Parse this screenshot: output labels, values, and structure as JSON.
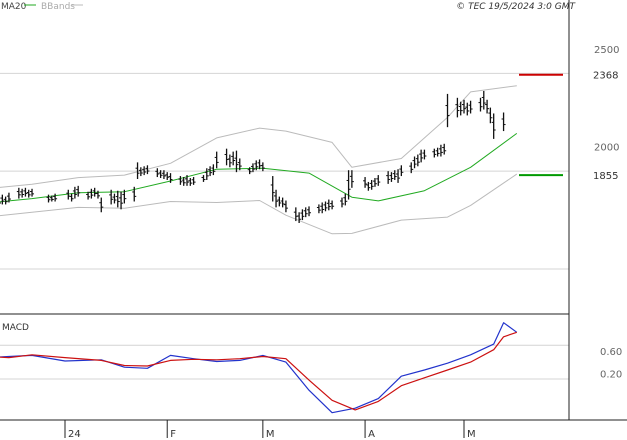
{
  "chart_data": {
    "type": "line",
    "copyright": "© TEC 19/5/2024 3:0 GMT",
    "legend": [
      {
        "name": "MA20",
        "color": "#22aa22"
      },
      {
        "name": "BBands",
        "color": "#bbbbbb"
      }
    ],
    "price_axis": {
      "ticks": [
        "2500",
        "2000"
      ],
      "ylim": [
        1150,
        2750
      ]
    },
    "macd": {
      "label": "MACD",
      "ticks": [
        "0.60",
        "0.20"
      ],
      "ylim": [
        -0.63,
        1.22
      ]
    },
    "x_axis": {
      "tick_labels": [
        "24",
        "F",
        "M",
        "A",
        "M"
      ],
      "tick_dates": [
        "2024-01-01",
        "2024-02-01",
        "2024-03-01",
        "2024-04-01",
        "2024-05-01"
      ]
    },
    "levels": [
      {
        "label": "2368",
        "value": 2368,
        "color": "#cc0000"
      },
      {
        "label": "1855",
        "value": 1855,
        "color": "#009900"
      }
    ],
    "series": [
      {
        "name": "MA20",
        "color": "#22aa22",
        "points": [
          [
            "2023-12-08",
            1712
          ],
          [
            "2023-12-22",
            1735
          ],
          [
            "2024-01-05",
            1765
          ],
          [
            "2024-01-19",
            1770
          ],
          [
            "2024-02-02",
            1825
          ],
          [
            "2024-02-16",
            1885
          ],
          [
            "2024-03-01",
            1890
          ],
          [
            "2024-03-15",
            1865
          ],
          [
            "2024-03-28",
            1742
          ],
          [
            "2024-04-05",
            1723
          ],
          [
            "2024-04-19",
            1775
          ],
          [
            "2024-05-03",
            1895
          ],
          [
            "2024-05-17",
            2068
          ]
        ]
      },
      {
        "name": "BBand upper",
        "color": "#bbbbbb",
        "points": [
          [
            "2023-12-08",
            1785
          ],
          [
            "2023-12-22",
            1808
          ],
          [
            "2024-01-05",
            1842
          ],
          [
            "2024-01-19",
            1855
          ],
          [
            "2024-02-02",
            1915
          ],
          [
            "2024-02-16",
            2045
          ],
          [
            "2024-02-29",
            2095
          ],
          [
            "2024-03-08",
            2080
          ],
          [
            "2024-03-22",
            2022
          ],
          [
            "2024-03-28",
            1895
          ],
          [
            "2024-04-12",
            1940
          ],
          [
            "2024-04-26",
            2150
          ],
          [
            "2024-05-03",
            2280
          ],
          [
            "2024-05-17",
            2312
          ]
        ]
      },
      {
        "name": "BBand lower",
        "color": "#bbbbbb",
        "points": [
          [
            "2023-12-08",
            1640
          ],
          [
            "2023-12-22",
            1665
          ],
          [
            "2024-01-05",
            1690
          ],
          [
            "2024-01-19",
            1685
          ],
          [
            "2024-02-02",
            1720
          ],
          [
            "2024-02-16",
            1715
          ],
          [
            "2024-02-29",
            1725
          ],
          [
            "2024-03-08",
            1650
          ],
          [
            "2024-03-22",
            1555
          ],
          [
            "2024-03-28",
            1557
          ],
          [
            "2024-04-12",
            1625
          ],
          [
            "2024-04-26",
            1640
          ],
          [
            "2024-05-03",
            1700
          ],
          [
            "2024-05-17",
            1860
          ]
        ]
      },
      {
        "name": "MACD",
        "color": "#2233cc",
        "points": [
          [
            "2023-12-01",
            0.58
          ],
          [
            "2023-12-08",
            0.48
          ],
          [
            "2023-12-15",
            0.5
          ],
          [
            "2023-12-22",
            0.52
          ],
          [
            "2024-01-01",
            0.42
          ],
          [
            "2024-01-12",
            0.44
          ],
          [
            "2024-01-19",
            0.31
          ],
          [
            "2024-01-26",
            0.29
          ],
          [
            "2024-02-02",
            0.52
          ],
          [
            "2024-02-09",
            0.46
          ],
          [
            "2024-02-16",
            0.41
          ],
          [
            "2024-02-23",
            0.43
          ],
          [
            "2024-03-01",
            0.52
          ],
          [
            "2024-03-08",
            0.4
          ],
          [
            "2024-03-15",
            -0.1
          ],
          [
            "2024-03-22",
            -0.5
          ],
          [
            "2024-03-29",
            -0.42
          ],
          [
            "2024-04-05",
            -0.25
          ],
          [
            "2024-04-12",
            0.15
          ],
          [
            "2024-04-19",
            0.26
          ],
          [
            "2024-04-26",
            0.38
          ],
          [
            "2024-05-03",
            0.53
          ],
          [
            "2024-05-10",
            0.72
          ],
          [
            "2024-05-13",
            1.1
          ],
          [
            "2024-05-17",
            0.93
          ]
        ]
      },
      {
        "name": "Signal",
        "color": "#cc1111",
        "points": [
          [
            "2023-12-01",
            0.6
          ],
          [
            "2023-12-08",
            0.5
          ],
          [
            "2023-12-15",
            0.48
          ],
          [
            "2023-12-22",
            0.53
          ],
          [
            "2024-01-01",
            0.48
          ],
          [
            "2024-01-12",
            0.43
          ],
          [
            "2024-01-19",
            0.34
          ],
          [
            "2024-01-26",
            0.33
          ],
          [
            "2024-02-02",
            0.43
          ],
          [
            "2024-02-09",
            0.45
          ],
          [
            "2024-02-16",
            0.44
          ],
          [
            "2024-02-23",
            0.46
          ],
          [
            "2024-03-01",
            0.5
          ],
          [
            "2024-03-08",
            0.46
          ],
          [
            "2024-03-15",
            0.08
          ],
          [
            "2024-03-22",
            -0.28
          ],
          [
            "2024-03-29",
            -0.45
          ],
          [
            "2024-04-05",
            -0.3
          ],
          [
            "2024-04-12",
            -0.02
          ],
          [
            "2024-04-19",
            0.12
          ],
          [
            "2024-04-26",
            0.26
          ],
          [
            "2024-05-03",
            0.4
          ],
          [
            "2024-05-10",
            0.62
          ],
          [
            "2024-05-13",
            0.85
          ],
          [
            "2024-05-17",
            0.93
          ]
        ]
      }
    ],
    "ohlc": [
      [
        "2023-12-01",
        1730,
        1690
      ],
      [
        "2023-12-04",
        1720,
        1660
      ],
      [
        "2023-12-05",
        1695,
        1640
      ],
      [
        "2023-12-06",
        1700,
        1645
      ],
      [
        "2023-12-07",
        1730,
        1675
      ],
      [
        "2023-12-08",
        1735,
        1690
      ],
      [
        "2023-12-11",
        1740,
        1695
      ],
      [
        "2023-12-12",
        1735,
        1700
      ],
      [
        "2023-12-13",
        1755,
        1705
      ],
      [
        "2023-12-14",
        1745,
        1705
      ],
      [
        "2023-12-15",
        1765,
        1715
      ],
      [
        "2023-12-18",
        1790,
        1735
      ],
      [
        "2023-12-19",
        1785,
        1740
      ],
      [
        "2023-12-20",
        1790,
        1745
      ],
      [
        "2023-12-21",
        1780,
        1740
      ],
      [
        "2023-12-22",
        1785,
        1745
      ],
      [
        "2023-12-27",
        1755,
        1715
      ],
      [
        "2023-12-28",
        1750,
        1720
      ],
      [
        "2023-12-29",
        1760,
        1720
      ],
      [
        "2024-01-02",
        1780,
        1730
      ],
      [
        "2024-01-03",
        1760,
        1720
      ],
      [
        "2024-01-04",
        1795,
        1735
      ],
      [
        "2024-01-05",
        1800,
        1745
      ],
      [
        "2024-01-08",
        1770,
        1730
      ],
      [
        "2024-01-09",
        1785,
        1735
      ],
      [
        "2024-01-10",
        1790,
        1745
      ],
      [
        "2024-01-11",
        1775,
        1735
      ],
      [
        "2024-01-12",
        1740,
        1665
      ],
      [
        "2024-01-15",
        1780,
        1705
      ],
      [
        "2024-01-16",
        1760,
        1710
      ],
      [
        "2024-01-17",
        1775,
        1690
      ],
      [
        "2024-01-18",
        1770,
        1680
      ],
      [
        "2024-01-19",
        1780,
        1710
      ],
      [
        "2024-01-22",
        1795,
        1720
      ],
      [
        "2024-01-23",
        1920,
        1835
      ],
      [
        "2024-01-24",
        1895,
        1850
      ],
      [
        "2024-01-25",
        1900,
        1855
      ],
      [
        "2024-01-26",
        1905,
        1860
      ],
      [
        "2024-01-29",
        1890,
        1845
      ],
      [
        "2024-01-30",
        1880,
        1840
      ],
      [
        "2024-01-31",
        1880,
        1835
      ],
      [
        "2024-02-01",
        1870,
        1830
      ],
      [
        "2024-02-02",
        1865,
        1815
      ],
      [
        "2024-02-05",
        1850,
        1805
      ],
      [
        "2024-02-06",
        1845,
        1800
      ],
      [
        "2024-02-07",
        1855,
        1800
      ],
      [
        "2024-02-08",
        1840,
        1800
      ],
      [
        "2024-02-09",
        1845,
        1805
      ],
      [
        "2024-02-12",
        1855,
        1820
      ],
      [
        "2024-02-13",
        1890,
        1830
      ],
      [
        "2024-02-14",
        1900,
        1850
      ],
      [
        "2024-02-15",
        1910,
        1855
      ],
      [
        "2024-02-16",
        1975,
        1890
      ],
      [
        "2024-02-19",
        1990,
        1905
      ],
      [
        "2024-02-20",
        1960,
        1895
      ],
      [
        "2024-02-21",
        1975,
        1905
      ],
      [
        "2024-02-22",
        1980,
        1870
      ],
      [
        "2024-02-23",
        1940,
        1880
      ],
      [
        "2024-02-26",
        1895,
        1860
      ],
      [
        "2024-02-27",
        1915,
        1870
      ],
      [
        "2024-02-28",
        1930,
        1880
      ],
      [
        "2024-02-29",
        1935,
        1885
      ],
      [
        "2024-03-01",
        1920,
        1875
      ],
      [
        "2024-03-04",
        1850,
        1720
      ],
      [
        "2024-03-05",
        1780,
        1690
      ],
      [
        "2024-03-06",
        1745,
        1695
      ],
      [
        "2024-03-07",
        1740,
        1690
      ],
      [
        "2024-03-08",
        1725,
        1665
      ],
      [
        "2024-03-11",
        1690,
        1620
      ],
      [
        "2024-03-12",
        1665,
        1610
      ],
      [
        "2024-03-13",
        1680,
        1625
      ],
      [
        "2024-03-14",
        1690,
        1640
      ],
      [
        "2024-03-15",
        1695,
        1645
      ],
      [
        "2024-03-18",
        1705,
        1660
      ],
      [
        "2024-03-19",
        1715,
        1660
      ],
      [
        "2024-03-20",
        1720,
        1670
      ],
      [
        "2024-03-21",
        1730,
        1675
      ],
      [
        "2024-03-22",
        1725,
        1680
      ],
      [
        "2024-03-25",
        1740,
        1690
      ],
      [
        "2024-03-26",
        1760,
        1700
      ],
      [
        "2024-03-27",
        1880,
        1730
      ],
      [
        "2024-03-28",
        1880,
        1790
      ],
      [
        "2024-04-01",
        1845,
        1790
      ],
      [
        "2024-04-02",
        1820,
        1775
      ],
      [
        "2024-04-03",
        1830,
        1780
      ],
      [
        "2024-04-04",
        1840,
        1795
      ],
      [
        "2024-04-05",
        1855,
        1800
      ],
      [
        "2024-04-08",
        1875,
        1810
      ],
      [
        "2024-04-09",
        1870,
        1820
      ],
      [
        "2024-04-10",
        1880,
        1830
      ],
      [
        "2024-04-11",
        1885,
        1815
      ],
      [
        "2024-04-12",
        1905,
        1850
      ],
      [
        "2024-04-15",
        1920,
        1865
      ],
      [
        "2024-04-16",
        1950,
        1890
      ],
      [
        "2024-04-17",
        1960,
        1900
      ],
      [
        "2024-04-18",
        1985,
        1920
      ],
      [
        "2024-04-19",
        1985,
        1935
      ],
      [
        "2024-04-22",
        1990,
        1945
      ],
      [
        "2024-04-23",
        1995,
        1950
      ],
      [
        "2024-04-24",
        2010,
        1950
      ],
      [
        "2024-04-25",
        2015,
        1960
      ],
      [
        "2024-04-26",
        2270,
        2100
      ],
      [
        "2024-04-29",
        2250,
        2150
      ],
      [
        "2024-04-30",
        2230,
        2160
      ],
      [
        "2024-05-01",
        2240,
        2170
      ],
      [
        "2024-05-02",
        2225,
        2160
      ],
      [
        "2024-05-03",
        2235,
        2170
      ],
      [
        "2024-05-06",
        2250,
        2180
      ],
      [
        "2024-05-07",
        2285,
        2190
      ],
      [
        "2024-05-08",
        2240,
        2170
      ],
      [
        "2024-05-09",
        2200,
        2120
      ],
      [
        "2024-05-10",
        2170,
        2040
      ],
      [
        "2024-05-13",
        2175,
        2080
      ]
    ]
  }
}
